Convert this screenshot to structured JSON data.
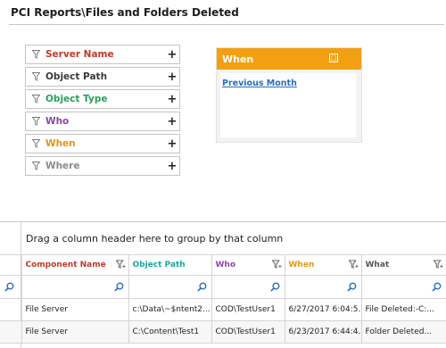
{
  "page": {
    "title": "PCI Reports\\Files and Folders Deleted"
  },
  "colors": {
    "server_name": "#c0392b",
    "object_path": "#3a3a3a",
    "object_type": "#27a05a",
    "who": "#8e44ad",
    "when": "#e6950e",
    "where": "#8a8a8a",
    "component_name": "#c0392b",
    "object_path_col": "#1aa89a",
    "who_col": "#8e44ad",
    "when_col": "#e6950e",
    "what_col": "#555555",
    "link": "#2a6ebb",
    "accent": "#f2a012"
  },
  "filters": [
    {
      "label": "Server Name",
      "icon": "funnel-icon"
    },
    {
      "label": "Object Path",
      "icon": "funnel-icon"
    },
    {
      "label": "Object Type",
      "icon": "funnel-icon"
    },
    {
      "label": "Who",
      "icon": "funnel-icon"
    },
    {
      "label": "When",
      "icon": "funnel-icon"
    },
    {
      "label": "Where",
      "icon": "funnel-icon"
    }
  ],
  "when_panel": {
    "header": "When",
    "link": "Previous Month"
  },
  "grid": {
    "group_hint": "Drag a column header here to group by that column",
    "columns": [
      "Component Name",
      "Object Path",
      "Who",
      "When",
      "What"
    ],
    "rows": [
      [
        "File Server",
        "c:\\Data\\~$ntent2...",
        "COD\\TestUser1",
        "6/27/2017 6:04:5...",
        "File Deleted:-C:..."
      ],
      [
        "File Server",
        "C:\\Content\\Test1",
        "COD\\TestUser1",
        "6/23/2017 6:44:4...",
        "Folder Deleted..."
      ]
    ]
  }
}
